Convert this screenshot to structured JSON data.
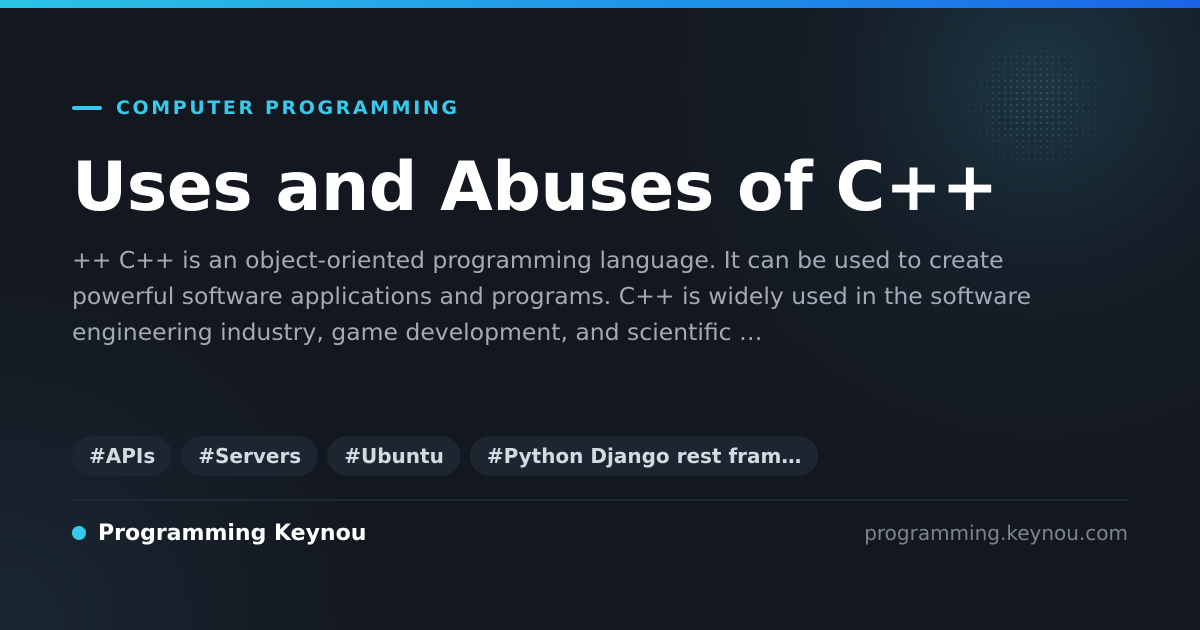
{
  "category": {
    "label": "COMPUTER PROGRAMMING"
  },
  "article": {
    "title": "Uses and Abuses of C++",
    "description": "++ C++ is an object-oriented programming language. It can be used to create powerful software applications and programs. C++ is widely used in the software engineering industry, game development, and scientific …"
  },
  "tags": [
    "#APIs",
    "#Servers",
    "#Ubuntu",
    "#Python Django rest fram…"
  ],
  "footer": {
    "brand_name": "Programming Keynou",
    "domain": "programming.keynou.com"
  },
  "colors": {
    "accent": "#38c8ea",
    "background": "#13171f",
    "top_bar_start": "#2bc4e6",
    "top_bar_end": "#1a64e6",
    "title": "#ffffff",
    "description": "#a3aab5",
    "tag_background": "#1d2530",
    "domain": "#7b8490"
  },
  "icons": {
    "category_marker": "accent-line",
    "brand_marker": "dot-icon",
    "decoration": "dot-pattern"
  }
}
